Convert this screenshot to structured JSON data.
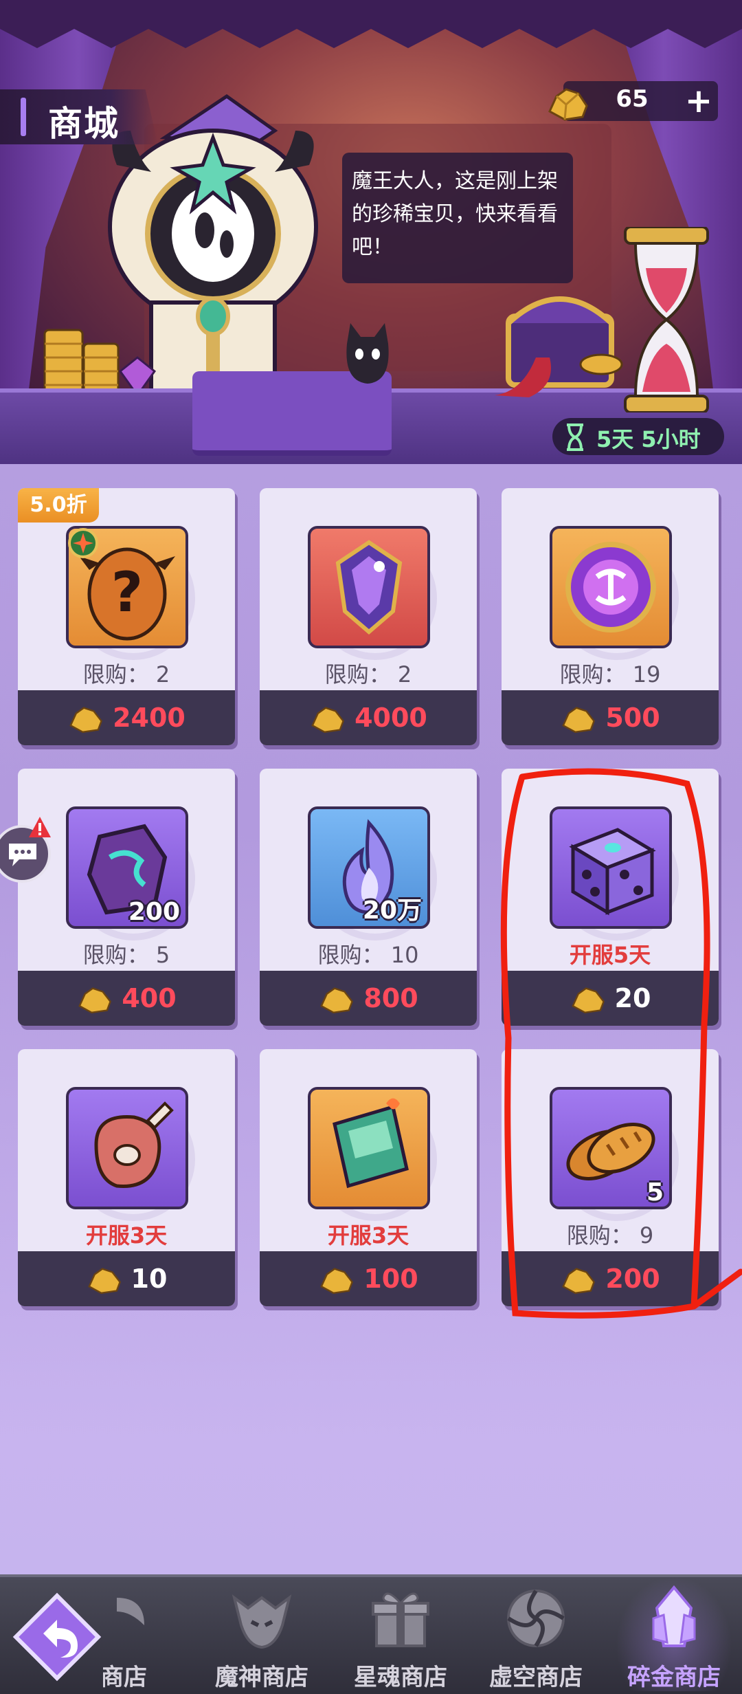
{
  "header": {
    "title": "商城",
    "currency_value": "65",
    "plus_label": "+",
    "speech_line1": "魔王大人，这是刚上架",
    "speech_line2": "的珍稀宝贝，快来看看",
    "speech_line3": "吧！",
    "timer": "5天 5小时"
  },
  "items": [
    {
      "name": "mystery-egg",
      "badge": "5.0折",
      "limit": "限购： 2",
      "price": "2400",
      "qty": ""
    },
    {
      "name": "crystal-amulet",
      "limit": "限购： 2",
      "price": "4000",
      "qty": ""
    },
    {
      "name": "rune-coin",
      "limit": "限购： 19",
      "price": "500",
      "qty": ""
    },
    {
      "name": "rune-stone",
      "limit": "限购： 5",
      "price": "400",
      "qty": "200"
    },
    {
      "name": "spirit-flame",
      "limit": "限购： 10",
      "price": "800",
      "qty": "20万"
    },
    {
      "name": "purple-dice",
      "limit": "开服5天",
      "price": "20",
      "qty": ""
    },
    {
      "name": "ham",
      "limit": "开服3天",
      "price": "10",
      "qty": ""
    },
    {
      "name": "ticket",
      "limit": "开服3天",
      "price": "100",
      "qty": ""
    },
    {
      "name": "bread",
      "limit": "限购： 9",
      "price": "200",
      "qty": "5"
    }
  ],
  "nav": {
    "items": [
      {
        "label": "商店"
      },
      {
        "label": "魔神商店"
      },
      {
        "label": "星魂商店"
      },
      {
        "label": "虚空商店"
      },
      {
        "label": "碎金商店"
      }
    ]
  },
  "colors": {
    "price_red": "#ff4b5c",
    "accent_purple": "#a77ef0",
    "limit_red": "#e23d3d",
    "highlight_red": "#f02010"
  },
  "icons": {
    "currency": "gold-ore-icon",
    "back": "back-arrow-icon",
    "chat": "chat-bubble-icon",
    "timer": "hourglass-icon"
  }
}
